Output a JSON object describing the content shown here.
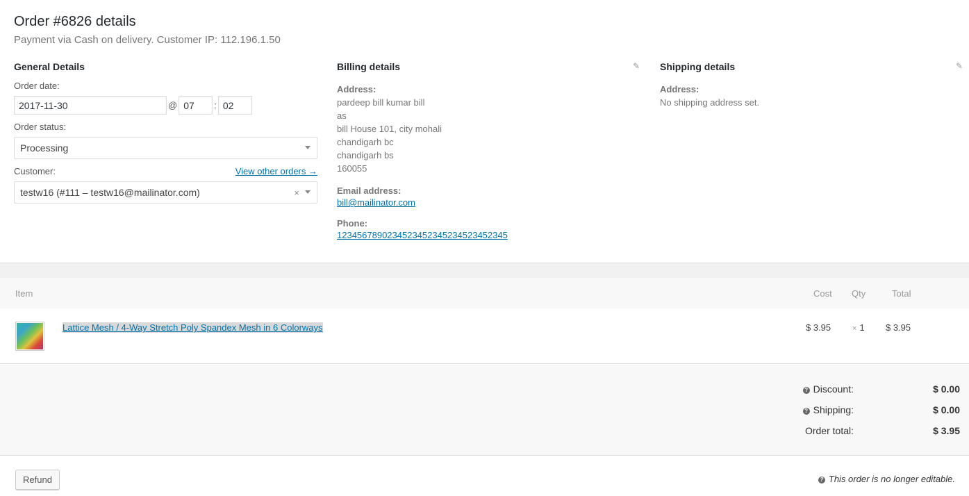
{
  "header": {
    "title": "Order #6826 details",
    "subtitle": "Payment via Cash on delivery. Customer IP: 112.196.1.50"
  },
  "general": {
    "heading": "General Details",
    "order_date_label": "Order date:",
    "order_date": "2017-11-30",
    "at": "@",
    "hour": "07",
    "colon": ":",
    "minute": "02",
    "status_label": "Order status:",
    "status_value": "Processing",
    "customer_label": "Customer:",
    "view_orders_link": "View other orders →",
    "customer_value": "testw16 (#111 – testw16@mailinator.com)",
    "clear_glyph": "×"
  },
  "billing": {
    "heading": "Billing details",
    "address_label": "Address:",
    "address_lines": [
      "pardeep bill kumar bill",
      "as",
      "bill House 101, city mohali",
      "chandigarh bc",
      "chandigarh bs",
      "160055"
    ],
    "email_label": "Email address:",
    "email": "bill@mailinator.com",
    "phone_label": "Phone:",
    "phone": "1234567890234523452345234523452345"
  },
  "shipping": {
    "heading": "Shipping details",
    "address_label": "Address:",
    "address_value": "No shipping address set."
  },
  "edit_glyph": "✎",
  "items": {
    "columns": {
      "item": "Item",
      "cost": "Cost",
      "qty": "Qty",
      "total": "Total"
    },
    "rows": [
      {
        "name": "Lattice Mesh / 4-Way Stretch Poly Spandex Mesh in 6 Colorways",
        "cost": "$ 3.95",
        "qty_prefix": "×",
        "qty": "1",
        "total": "$ 3.95"
      }
    ]
  },
  "totals": {
    "discount_label": "Discount:",
    "discount": "$ 0.00",
    "shipping_label": "Shipping:",
    "shipping": "$ 0.00",
    "order_total_label": "Order total:",
    "order_total": "$ 3.95",
    "help_glyph": "?"
  },
  "footer": {
    "refund_label": "Refund",
    "not_editable": "This order is no longer editable."
  }
}
